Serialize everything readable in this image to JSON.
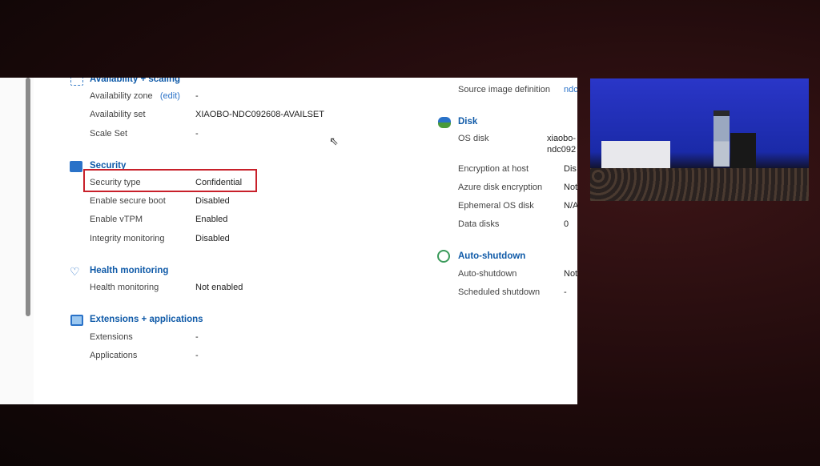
{
  "left": {
    "availability": {
      "title": "Availability + scaling",
      "rows": [
        {
          "label": "Availability zone",
          "link": "(edit)",
          "value": "-"
        },
        {
          "label": "Availability set",
          "value": "XIAOBO-NDC092608-AVAILSET"
        },
        {
          "label": "Scale Set",
          "value": "-"
        }
      ]
    },
    "security": {
      "title": "Security",
      "rows": [
        {
          "label": "Security type",
          "value": "Confidential"
        },
        {
          "label": "Enable secure boot",
          "value": "Disabled"
        },
        {
          "label": "Enable vTPM",
          "value": "Enabled"
        },
        {
          "label": "Integrity monitoring",
          "value": "Disabled"
        }
      ]
    },
    "health": {
      "title": "Health monitoring",
      "rows": [
        {
          "label": "Health monitoring",
          "value": "Not enabled"
        }
      ]
    },
    "extensions": {
      "title": "Extensions + applications",
      "rows": [
        {
          "label": "Extensions",
          "value": "-"
        },
        {
          "label": "Applications",
          "value": "-"
        }
      ]
    }
  },
  "right": {
    "source": {
      "label": "Source image definition",
      "value": "ndc"
    },
    "disk": {
      "title": "Disk",
      "os_label": "OS disk",
      "os_value1": "xiaobo-",
      "os_value2": "ndc092",
      "rows": [
        {
          "label": "Encryption at host",
          "value": "Dis"
        },
        {
          "label": "Azure disk encryption",
          "value": "Not"
        },
        {
          "label": "Ephemeral OS disk",
          "value": "N/A"
        },
        {
          "label": "Data disks",
          "value": "0"
        }
      ]
    },
    "autoshutdown": {
      "title": "Auto-shutdown",
      "rows": [
        {
          "label": "Auto-shutdown",
          "value": "Not"
        },
        {
          "label": "Scheduled shutdown",
          "value": "-"
        }
      ]
    }
  },
  "colors": {
    "heading": "#0f5aa8",
    "highlight": "#c8202a"
  }
}
